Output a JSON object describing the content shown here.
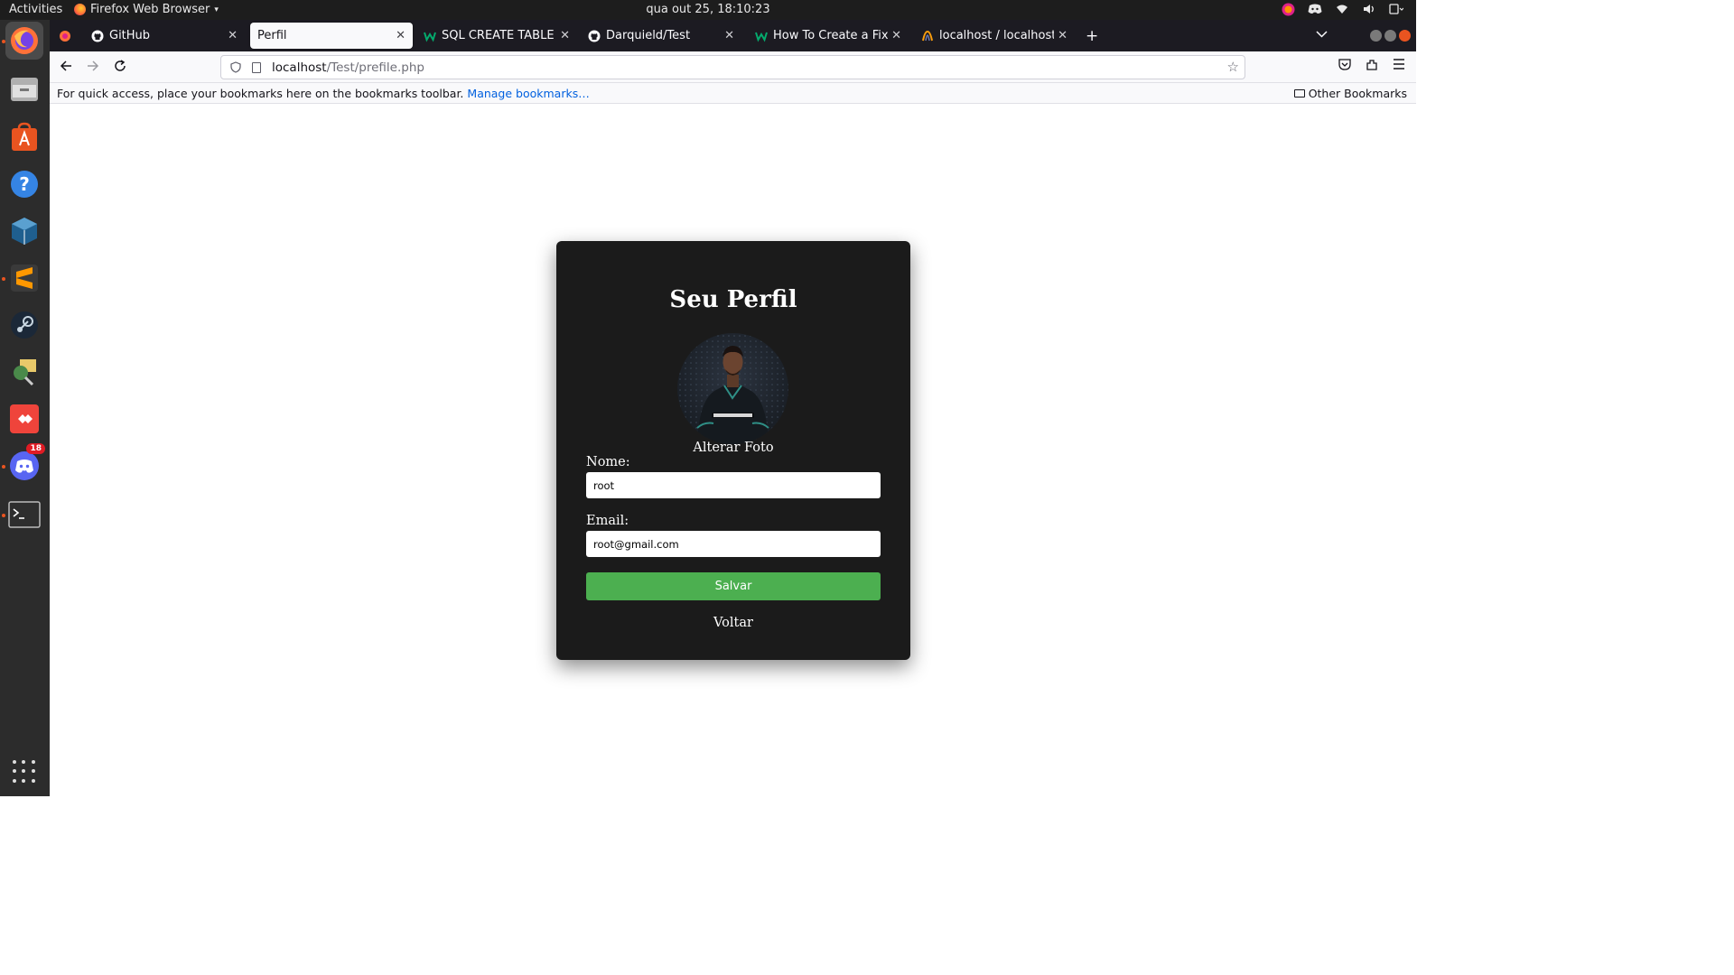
{
  "topbar": {
    "activities": "Activities",
    "app_name": "Firefox Web Browser",
    "clock": "qua out 25, 18:10:23"
  },
  "dock": {
    "items": [
      {
        "name": "firefox",
        "active": true
      },
      {
        "name": "files"
      },
      {
        "name": "app-center"
      },
      {
        "name": "help"
      },
      {
        "name": "virtualbox"
      },
      {
        "name": "sublime-text"
      },
      {
        "name": "steam"
      },
      {
        "name": "network-tool"
      },
      {
        "name": "anydesk"
      },
      {
        "name": "discord",
        "badge": "18"
      },
      {
        "name": "terminal"
      }
    ]
  },
  "tabs": [
    {
      "label": "GitHub",
      "icon": "github-icon"
    },
    {
      "label": "Perfil",
      "icon": "",
      "active": true
    },
    {
      "label": "SQL CREATE TABLE State",
      "icon": "w3schools-icon"
    },
    {
      "label": "Darquield/Test",
      "icon": "github-icon"
    },
    {
      "label": "How To Create a Fixed Fo",
      "icon": "w3schools-icon"
    },
    {
      "label": "localhost / localhost / wa",
      "icon": "phpmyadmin-icon"
    }
  ],
  "urlbar": {
    "host": "localhost",
    "path": "/Test/prefile.php"
  },
  "bookmarks": {
    "message": "For quick access, place your bookmarks here on the bookmarks toolbar.",
    "manage_link": "Manage bookmarks…",
    "other": "Other Bookmarks"
  },
  "profile": {
    "title": "Seu Perfil",
    "change_photo": "Alterar Foto",
    "name_label": "Nome:",
    "name_value": "root",
    "email_label": "Email:",
    "email_value": "root@gmail.com",
    "save_label": "Salvar",
    "back_label": "Voltar"
  },
  "colors": {
    "card_bg": "#1b1b1b",
    "save_button": "#4caf50",
    "link": "#0060df"
  }
}
